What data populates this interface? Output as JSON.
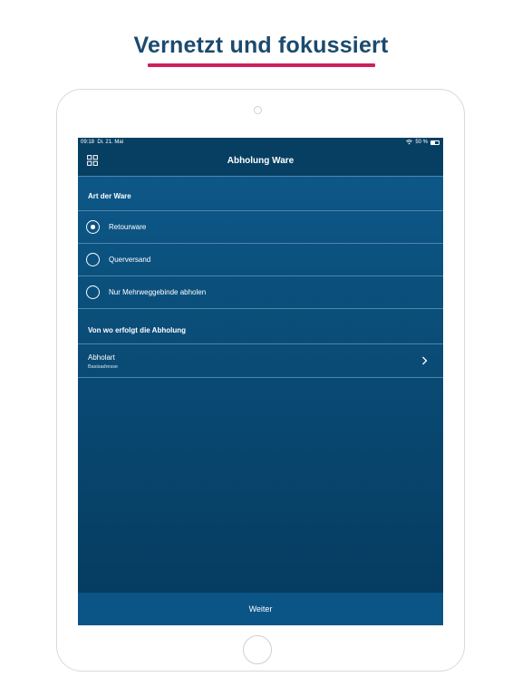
{
  "headline": "Vernetzt und fokussiert",
  "colors": {
    "accent": "#cf1f5f",
    "headline": "#1b4a6f",
    "app_background": "#0a4d78"
  },
  "status_bar": {
    "time": "09:18",
    "date": "Di. 21. Mai",
    "battery_text": "50 %",
    "battery_level": 0.5,
    "icons": [
      "wifi-icon",
      "battery-icon"
    ]
  },
  "nav": {
    "title": "Abholung Ware",
    "menu_icon": "grid-icon"
  },
  "section_goods": {
    "title": "Art der Ware",
    "options": [
      {
        "label": "Retourware",
        "selected": true
      },
      {
        "label": "Querversand",
        "selected": false
      },
      {
        "label": "Nur Mehrweggebinde abholen",
        "selected": false
      }
    ]
  },
  "section_location": {
    "title": "Von wo erfolgt die Abholung",
    "pickup": {
      "title": "Abholart",
      "subtitle": "Basisadresse",
      "icon": "chevron-right-icon"
    }
  },
  "footer": {
    "continue_label": "Weiter"
  }
}
